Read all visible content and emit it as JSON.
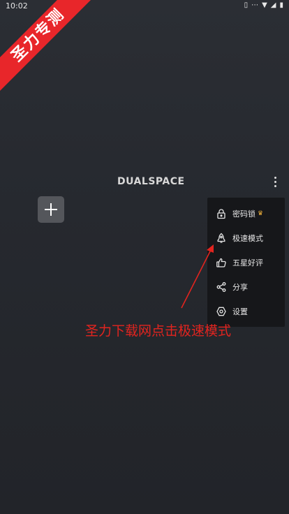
{
  "status": {
    "time": "10:02"
  },
  "watermark": {
    "text": "圣力专测"
  },
  "header": {
    "logo": "DUALSPACE"
  },
  "menu": {
    "items": [
      {
        "label": "密码锁",
        "icon": "lock-icon"
      },
      {
        "label": "极速模式",
        "icon": "rocket-icon"
      },
      {
        "label": "五星好评",
        "icon": "thumbs-up-icon"
      },
      {
        "label": "分享",
        "icon": "share-icon"
      },
      {
        "label": "设置",
        "icon": "settings-icon"
      }
    ]
  },
  "annotation": {
    "text": "圣力下载网点击极速模式"
  },
  "colors": {
    "accent": "#e8262a",
    "annotation": "#e2241f",
    "crown": "#f2b33a"
  }
}
